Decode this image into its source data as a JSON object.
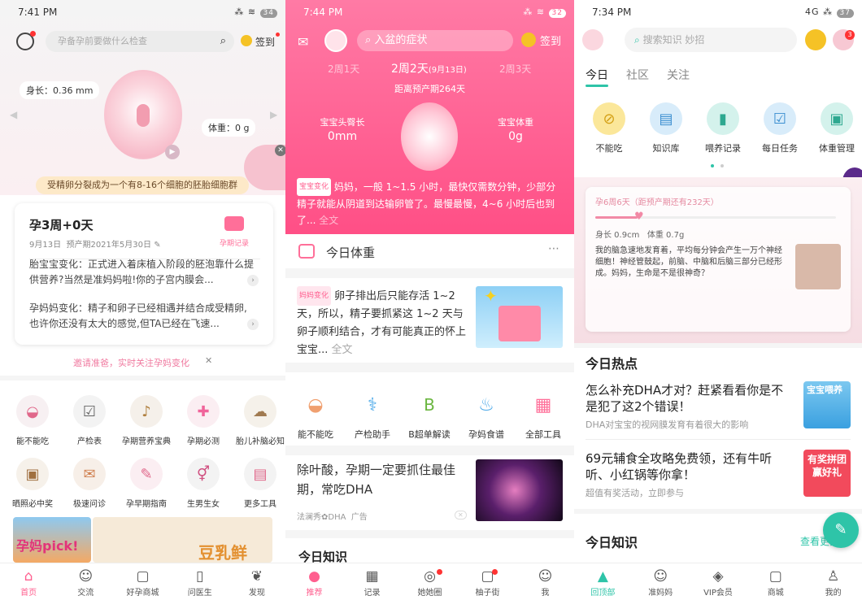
{
  "p1": {
    "status_time": "7:41 PM",
    "status_icons": "⁂ ≋",
    "battery": "34",
    "search_placeholder": "孕备孕前要做什么检查",
    "signin": "签到",
    "length_label": "身长：0.36 mm",
    "weight_label": "体重：0 g",
    "banner": "受精卵分裂成为一个有8-16个细胞的胚胎细胞群",
    "week": "孕3周+0天",
    "date": "9月13日",
    "due": "预产期2021年5月30日",
    "record": "孕期记录",
    "baby_change": "胎宝宝变化：正式进入着床植入阶段的胚泡靠什么提供营养?当然是准妈妈啦!你的子宫内膜会...",
    "mom_change": "孕妈妈变化：精子和卵子已经相遇并结合成受精卵,也许你还没有太大的感觉,但TA已经在飞速...",
    "invite": "邀请准爸，实时关注孕妈变化",
    "tools_row1": [
      "能不能吃",
      "产检表",
      "孕期营养宝典",
      "孕期必测",
      "胎儿补脑必知"
    ],
    "tools_row2": [
      "晒照必中奖",
      "极速问诊",
      "孕早期指南",
      "生男生女",
      "更多工具"
    ],
    "ad_text": "孕妈pick!",
    "ad_text2": "豆乳鲜",
    "tabs": [
      "首页",
      "交流",
      "好孕商城",
      "问医生",
      "发现"
    ]
  },
  "p2": {
    "status_time": "7:44 PM",
    "status_icons": "⁂ ≋",
    "battery": "32",
    "search_placeholder": "入盆的症状",
    "signin": "签到",
    "day_prev": "2周1天",
    "day_cur": "2周2天",
    "day_cur_date": "(9月13日)",
    "day_next": "2周3天",
    "countdown": "距离预产期264天",
    "crl_label": "宝宝头臀长",
    "crl_value": "0mm",
    "wt_label": "宝宝体重",
    "wt_value": "0g",
    "change_tag": "宝宝变化",
    "change_text": "妈妈，一般 1~1.5 小时，最快仅需数分钟，少部分精子就能从阴道到达输卵管了。最慢最慢，4~6 小时后也到了...",
    "change_more": "全文",
    "today_weight": "今日体重",
    "article_tag": "妈妈变化",
    "article_text": "卵子排出后只能存活 1~2 天，所以，精子要抓紧这 1~2 天与卵子顺利结合，才有可能真正的怀上宝宝...",
    "article_more": "全文",
    "tools": [
      "能不能吃",
      "产检助手",
      "B超单解读",
      "孕妈食谱",
      "全部工具"
    ],
    "ad_title": "除叶酸，孕期一定要抓住最佳期，常吃DHA",
    "ad_source": "法澜秀✿DHA",
    "ad_label": "广告",
    "section": "今日知识",
    "tabs": [
      "推荐",
      "记录",
      "她她圈",
      "柚子街",
      "我"
    ]
  },
  "p3": {
    "status_time": "7:34 PM",
    "status_icons": "4G ⁂",
    "battery": "37",
    "search_placeholder": "搜索知识 妙招",
    "tabs_top": [
      "今日",
      "社区",
      "关注"
    ],
    "tools": [
      "不能吃",
      "知识库",
      "喂养记录",
      "每日任务",
      "体重管理"
    ],
    "card_head": "孕6周6天（距预产期还有232天）",
    "card_len": "身长  0.9cm",
    "card_wt": "体重  0.7g",
    "card_text": "我的脑急速地发育着，平均每分钟会产生一万个神经细胞！神经管鼓起，前脑、中脑和后脑三部分已经形成。妈妈，生命是不是很神奇？",
    "hot_title": "今日热点",
    "hot1_title": "怎么补充DHA才对？赶紧看看你是不是犯了这2个错误！",
    "hot1_sub": "DHA对宝宝的视网膜发育有着很大的影响",
    "hot1_thumb": "宝宝喂养",
    "hot2_title": "69元辅食全攻略免费领，还有牛听听、小红锅等你拿！",
    "hot2_sub": "超值有奖活动，立即参与",
    "hot2_thumb": "有奖拼团赢好礼",
    "know_title": "今日知识",
    "know_more": "查看更多",
    "badge": "3",
    "tabs": [
      "回顶部",
      "准妈妈",
      "VIP会员",
      "商城",
      "我的"
    ]
  },
  "colors": {
    "pink": "#ff5f8f",
    "teal": "#2ec4a8",
    "gold": "#f5c226"
  }
}
